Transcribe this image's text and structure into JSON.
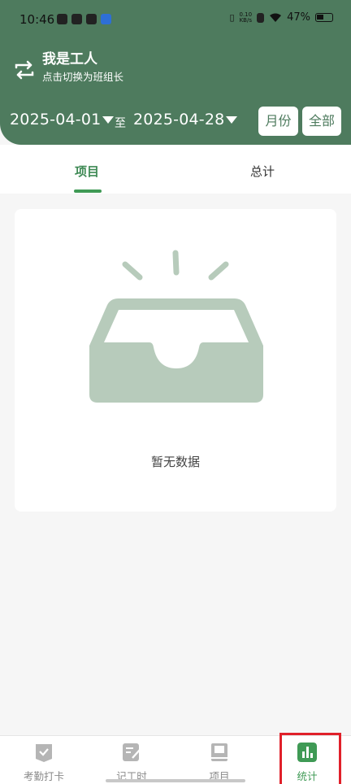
{
  "status_bar": {
    "time": "10:46",
    "speed_value": "0.10",
    "speed_unit": "KB/s",
    "battery_percent": "47%"
  },
  "header": {
    "role_title": "我是工人",
    "role_subtitle": "点击切换为班组长",
    "date_start": "2025-04-01",
    "date_separator": "至",
    "date_end": "2025-04-28",
    "month_button": "月份",
    "all_button": "全部",
    "swap_icon": "swap-arrows-icon"
  },
  "tabs": [
    {
      "label": "项目",
      "active": true
    },
    {
      "label": "总计",
      "active": false
    }
  ],
  "empty_state": {
    "icon": "empty-inbox-icon",
    "text": "暂无数据"
  },
  "bottom_nav": [
    {
      "label": "考勤打卡",
      "icon": "checkin-icon",
      "active": false
    },
    {
      "label": "记工时",
      "icon": "edit-hours-icon",
      "active": false
    },
    {
      "label": "项目",
      "icon": "book-icon",
      "active": false
    },
    {
      "label": "统计",
      "icon": "bar-chart-icon",
      "active": true
    }
  ],
  "colors": {
    "brand": "#4e7b5e",
    "accent": "#3f9a55",
    "empty_art": "#b7cbbb",
    "highlight": "#e0202a"
  }
}
